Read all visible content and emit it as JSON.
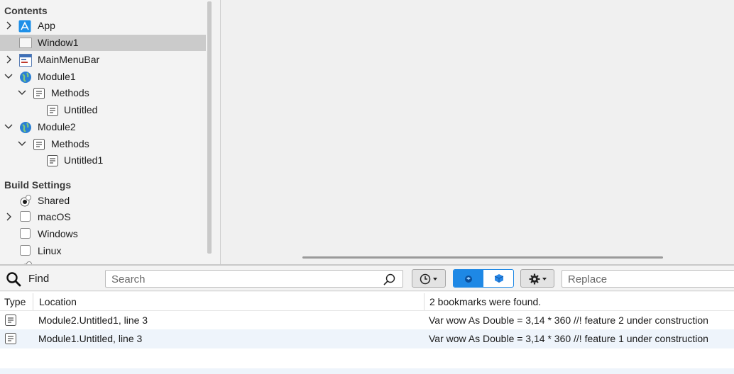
{
  "sidebar": {
    "contents_header": "Contents",
    "build_header": "Build Settings",
    "items": [
      {
        "label": "App"
      },
      {
        "label": "Window1"
      },
      {
        "label": "MainMenuBar"
      },
      {
        "label": "Module1"
      },
      {
        "label": "Methods"
      },
      {
        "label": "Untitled"
      },
      {
        "label": "Module2"
      },
      {
        "label": "Methods"
      },
      {
        "label": "Untitled1"
      }
    ],
    "build_items": [
      {
        "label": "Shared"
      },
      {
        "label": "macOS"
      },
      {
        "label": "Windows"
      },
      {
        "label": "Linux"
      }
    ]
  },
  "findbar": {
    "find_label": "Find",
    "search_placeholder": "Search",
    "replace_placeholder": "Replace"
  },
  "results": {
    "columns": {
      "type": "Type",
      "location": "Location",
      "status": "2 bookmarks were found."
    },
    "rows": [
      {
        "location": "Module2.Untitled1, line 3",
        "code": "Var wow As Double = 3,14 * 360  //! feature 2 under construction"
      },
      {
        "location": "Module1.Untitled, line 3",
        "code": "Var wow As Double = 3,14 * 360  //! feature 1 under construction"
      }
    ]
  },
  "colors": {
    "accent": "#1e88e5",
    "selection": "#cbcbcb",
    "alt_row": "#eef4fb"
  },
  "icons": [
    "chevron-right-icon",
    "chevron-down-icon",
    "app-icon",
    "window-icon",
    "menubar-icon",
    "module-globe-icon",
    "folder-methods-icon",
    "method-icon",
    "radio-icon",
    "checkbox-icon",
    "magnifier-icon",
    "history-icon",
    "gear-icon",
    "bookmark-icon"
  ]
}
